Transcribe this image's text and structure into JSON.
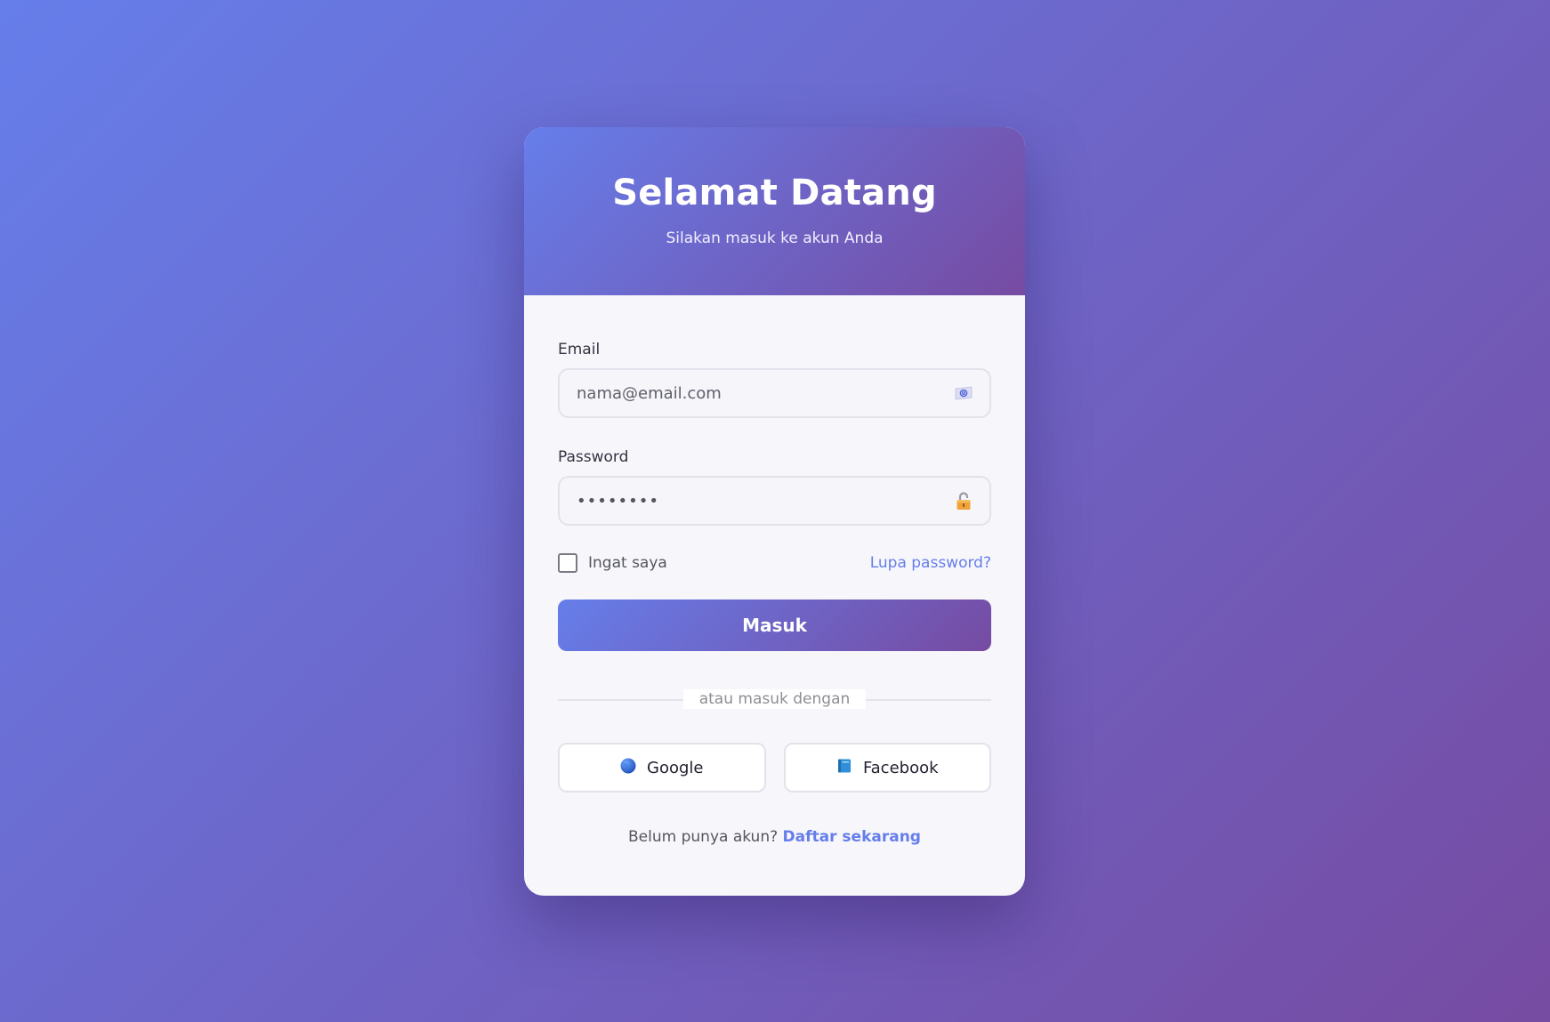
{
  "header": {
    "title": "Selamat Datang",
    "subtitle": "Silakan masuk ke akun Anda"
  },
  "form": {
    "email": {
      "label": "Email",
      "placeholder": "nama@email.com",
      "icon": "at-sign-icon"
    },
    "password": {
      "label": "Password",
      "value": "••••••••",
      "icon": "lock-icon"
    },
    "remember_label": "Ingat saya",
    "remember_checked": false,
    "forgot_link": "Lupa password?",
    "submit_label": "Masuk"
  },
  "divider": {
    "text": "atau masuk dengan"
  },
  "social": {
    "google_label": "Google",
    "google_icon": "globe-icon",
    "facebook_label": "Facebook",
    "facebook_icon": "blue-book-icon"
  },
  "footer": {
    "prompt": "Belum punya akun?",
    "signup_link": "Daftar sekarang"
  },
  "colors": {
    "gradient_start": "#667eea",
    "gradient_end": "#764ba2",
    "accent": "#667eea",
    "card_background": "#f7f7fb"
  }
}
